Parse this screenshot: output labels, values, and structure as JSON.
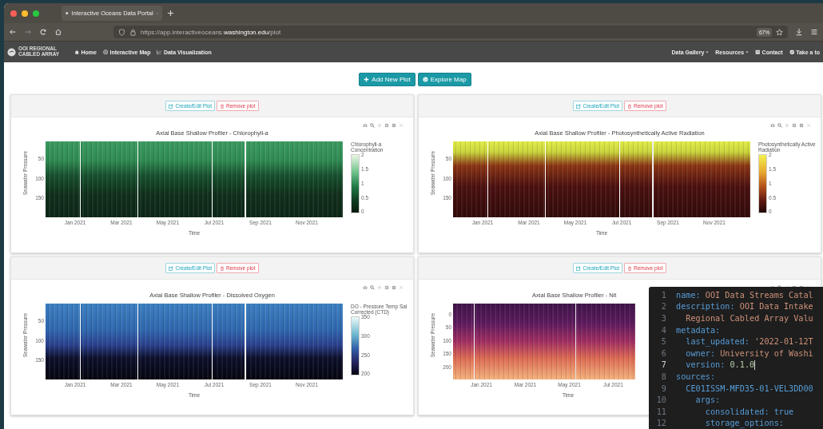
{
  "browser": {
    "tab_title": "Interactive Oceans Data Portal",
    "url_start": "https://app.interactiveoceans.",
    "url_domain": "washington.edu",
    "url_end": "/plot",
    "zoom": "67%"
  },
  "navbar": {
    "logo_text": "OOI REGIONAL CABLED ARRAY",
    "left_links": [
      {
        "label": "Home"
      },
      {
        "label": "Interactive Map"
      },
      {
        "label": "Data Visualization"
      }
    ],
    "right_links": [
      {
        "label": "Data Gallery",
        "dropdown": true
      },
      {
        "label": "Resources",
        "dropdown": true
      },
      {
        "label": "Contact",
        "dropdown": false
      },
      {
        "label": "Take a to",
        "dropdown": false
      }
    ]
  },
  "actions": [
    "Add New Plot",
    "Explore Map"
  ],
  "plots": [
    {
      "edit_label": "Create/Edit Plot",
      "remove_label": "Remove plot",
      "title": "Axial Base Shallow Profiler - Chlorophyll-a",
      "ylabel": "Seawater Pressure",
      "yticks": [
        "50",
        "100",
        "150"
      ],
      "xticks": [
        "Jan 2021",
        "Mar 2021",
        "May 2021",
        "Jul 2021",
        "Sep 2021",
        "Nov 2021"
      ],
      "xlabel": "Time",
      "kind": "greens",
      "colorbar_title": "Chlorophyll-a Concentration",
      "colorbar_ticks": [
        "2",
        "1.5",
        "1",
        "0.5",
        "0"
      ]
    },
    {
      "edit_label": "Create/Edit Plot",
      "remove_label": "Remove plot",
      "title": "Axial Base Shallow Profiler - Photosynthetically Active Radiation",
      "ylabel": "Seawater Pressure",
      "yticks": [
        "50",
        "100",
        "150"
      ],
      "xticks": [
        "Jan 2021",
        "Mar 2021",
        "May 2021",
        "Jul 2021",
        "Sep 2021",
        "Nov 2021"
      ],
      "xlabel": "Time",
      "kind": "hot",
      "colorbar_title": "Photosynthetically Active Radiation",
      "colorbar_ticks": [
        "2",
        "1.5",
        "1",
        "0.5",
        "0"
      ]
    },
    {
      "edit_label": "Create/Edit Plot",
      "remove_label": "Remove plot",
      "title": "Axial Base Shallow Profiler - Dissolved Oxygen",
      "ylabel": "Seawater Pressure",
      "yticks": [
        "50",
        "100",
        "150"
      ],
      "xticks": [
        "Jan 2021",
        "Mar 2021",
        "May 2021",
        "Jul 2021",
        "Sep 2021",
        "Nov 2021"
      ],
      "xlabel": "Time",
      "kind": "ice",
      "colorbar_title": "DO - Pressure Temp Sal Corrected (CTD)",
      "colorbar_ticks": [
        "350",
        "300",
        "250",
        "200"
      ]
    },
    {
      "edit_label": "Create/Edit Plot",
      "remove_label": "Remove plot",
      "title": "Axial Base Shallow Profiler - Nit",
      "ylabel": "Seawater Pressure",
      "yticks": [
        "0",
        "50",
        "100",
        "150",
        "200"
      ],
      "xticks": [
        "Jan 2021",
        "Mar 2021",
        "May 2021",
        "Jul 2021"
      ],
      "xlabel": "Time",
      "kind": "magma"
    }
  ],
  "editor": {
    "lines": [
      {
        "number": "1",
        "key": "name:",
        "value": " OOI Data Streams Catal",
        "kind": "string",
        "active": false
      },
      {
        "number": "2",
        "key": "description:",
        "value": " OOI Data Intake",
        "kind": "string",
        "active": false
      },
      {
        "number": "3",
        "value": "  Regional Cabled Array Valu",
        "kind": "string",
        "active": false
      },
      {
        "number": "4",
        "key": "metadata:",
        "active": false
      },
      {
        "number": "5",
        "key": "  last_updated:",
        "value": " '2022-01-12T",
        "kind": "string",
        "active": false
      },
      {
        "number": "6",
        "key": "  owner:",
        "value": " University of Washi",
        "kind": "string",
        "active": false
      },
      {
        "number": "7",
        "key": "  version:",
        "value": " 0.1.0",
        "kind": "number",
        "active": true
      },
      {
        "number": "8",
        "key": "sources:",
        "active": false
      },
      {
        "number": "9",
        "key": "  CE01ISSM-MFD35-01-VEL3DD00",
        "active": false
      },
      {
        "number": "10",
        "key": "    args:",
        "active": false
      },
      {
        "number": "11",
        "key": "      consolidated:",
        "value": " true",
        "kind": "keyword",
        "active": false
      },
      {
        "number": "12",
        "key": "      storage_options:",
        "active": false
      }
    ]
  }
}
